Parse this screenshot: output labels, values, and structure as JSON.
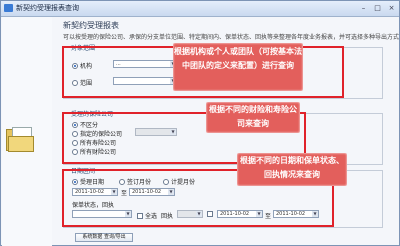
{
  "window": {
    "title": "新契约受理报表查询",
    "minimize": "–",
    "maximize": "□",
    "close": "×"
  },
  "heading": "新契约受理报表",
  "intro": "可以按受理的保险公司、承保的分支单位范围、特定期间内、保单状态、回执等来整理各年度业务报表，并可选择多种导出方式",
  "scope": {
    "label": "对象范围",
    "org_label": "机构",
    "org_value": "...",
    "scope_label": "范围"
  },
  "insurer": {
    "label": "受理的保险公司",
    "options": [
      "不区分",
      "指定的保险公司",
      "所有寿险公司",
      "所有财险公司"
    ],
    "selected": 0
  },
  "date": {
    "label": "日期区间",
    "options": [
      "受理日期",
      "签订月份",
      "计提月份"
    ],
    "selected": 0,
    "from": "2011-10-02",
    "to": "2011-10-02",
    "to_label": "至"
  },
  "status": {
    "label": "保单状态，回执",
    "all_label": "全选",
    "receipt_label": "回执",
    "from": "2011-10-02",
    "to": "2011-10-02",
    "to_label": "至"
  },
  "actions": {
    "query_button": "系统数据 查询/导出"
  },
  "callouts": {
    "scope_note": "根据机构或个人或团队（可按基本法中团队的定义来配置）进行查询",
    "insurer_note": "根据不同的财险和寿险公司来查询",
    "date_note": "根据不同的日期和保单状态、回执情况来查询"
  },
  "colors": {
    "accent_red": "#e0222a",
    "callout_bg": "#e35f5c",
    "title_bar": "#c9d9ef"
  }
}
